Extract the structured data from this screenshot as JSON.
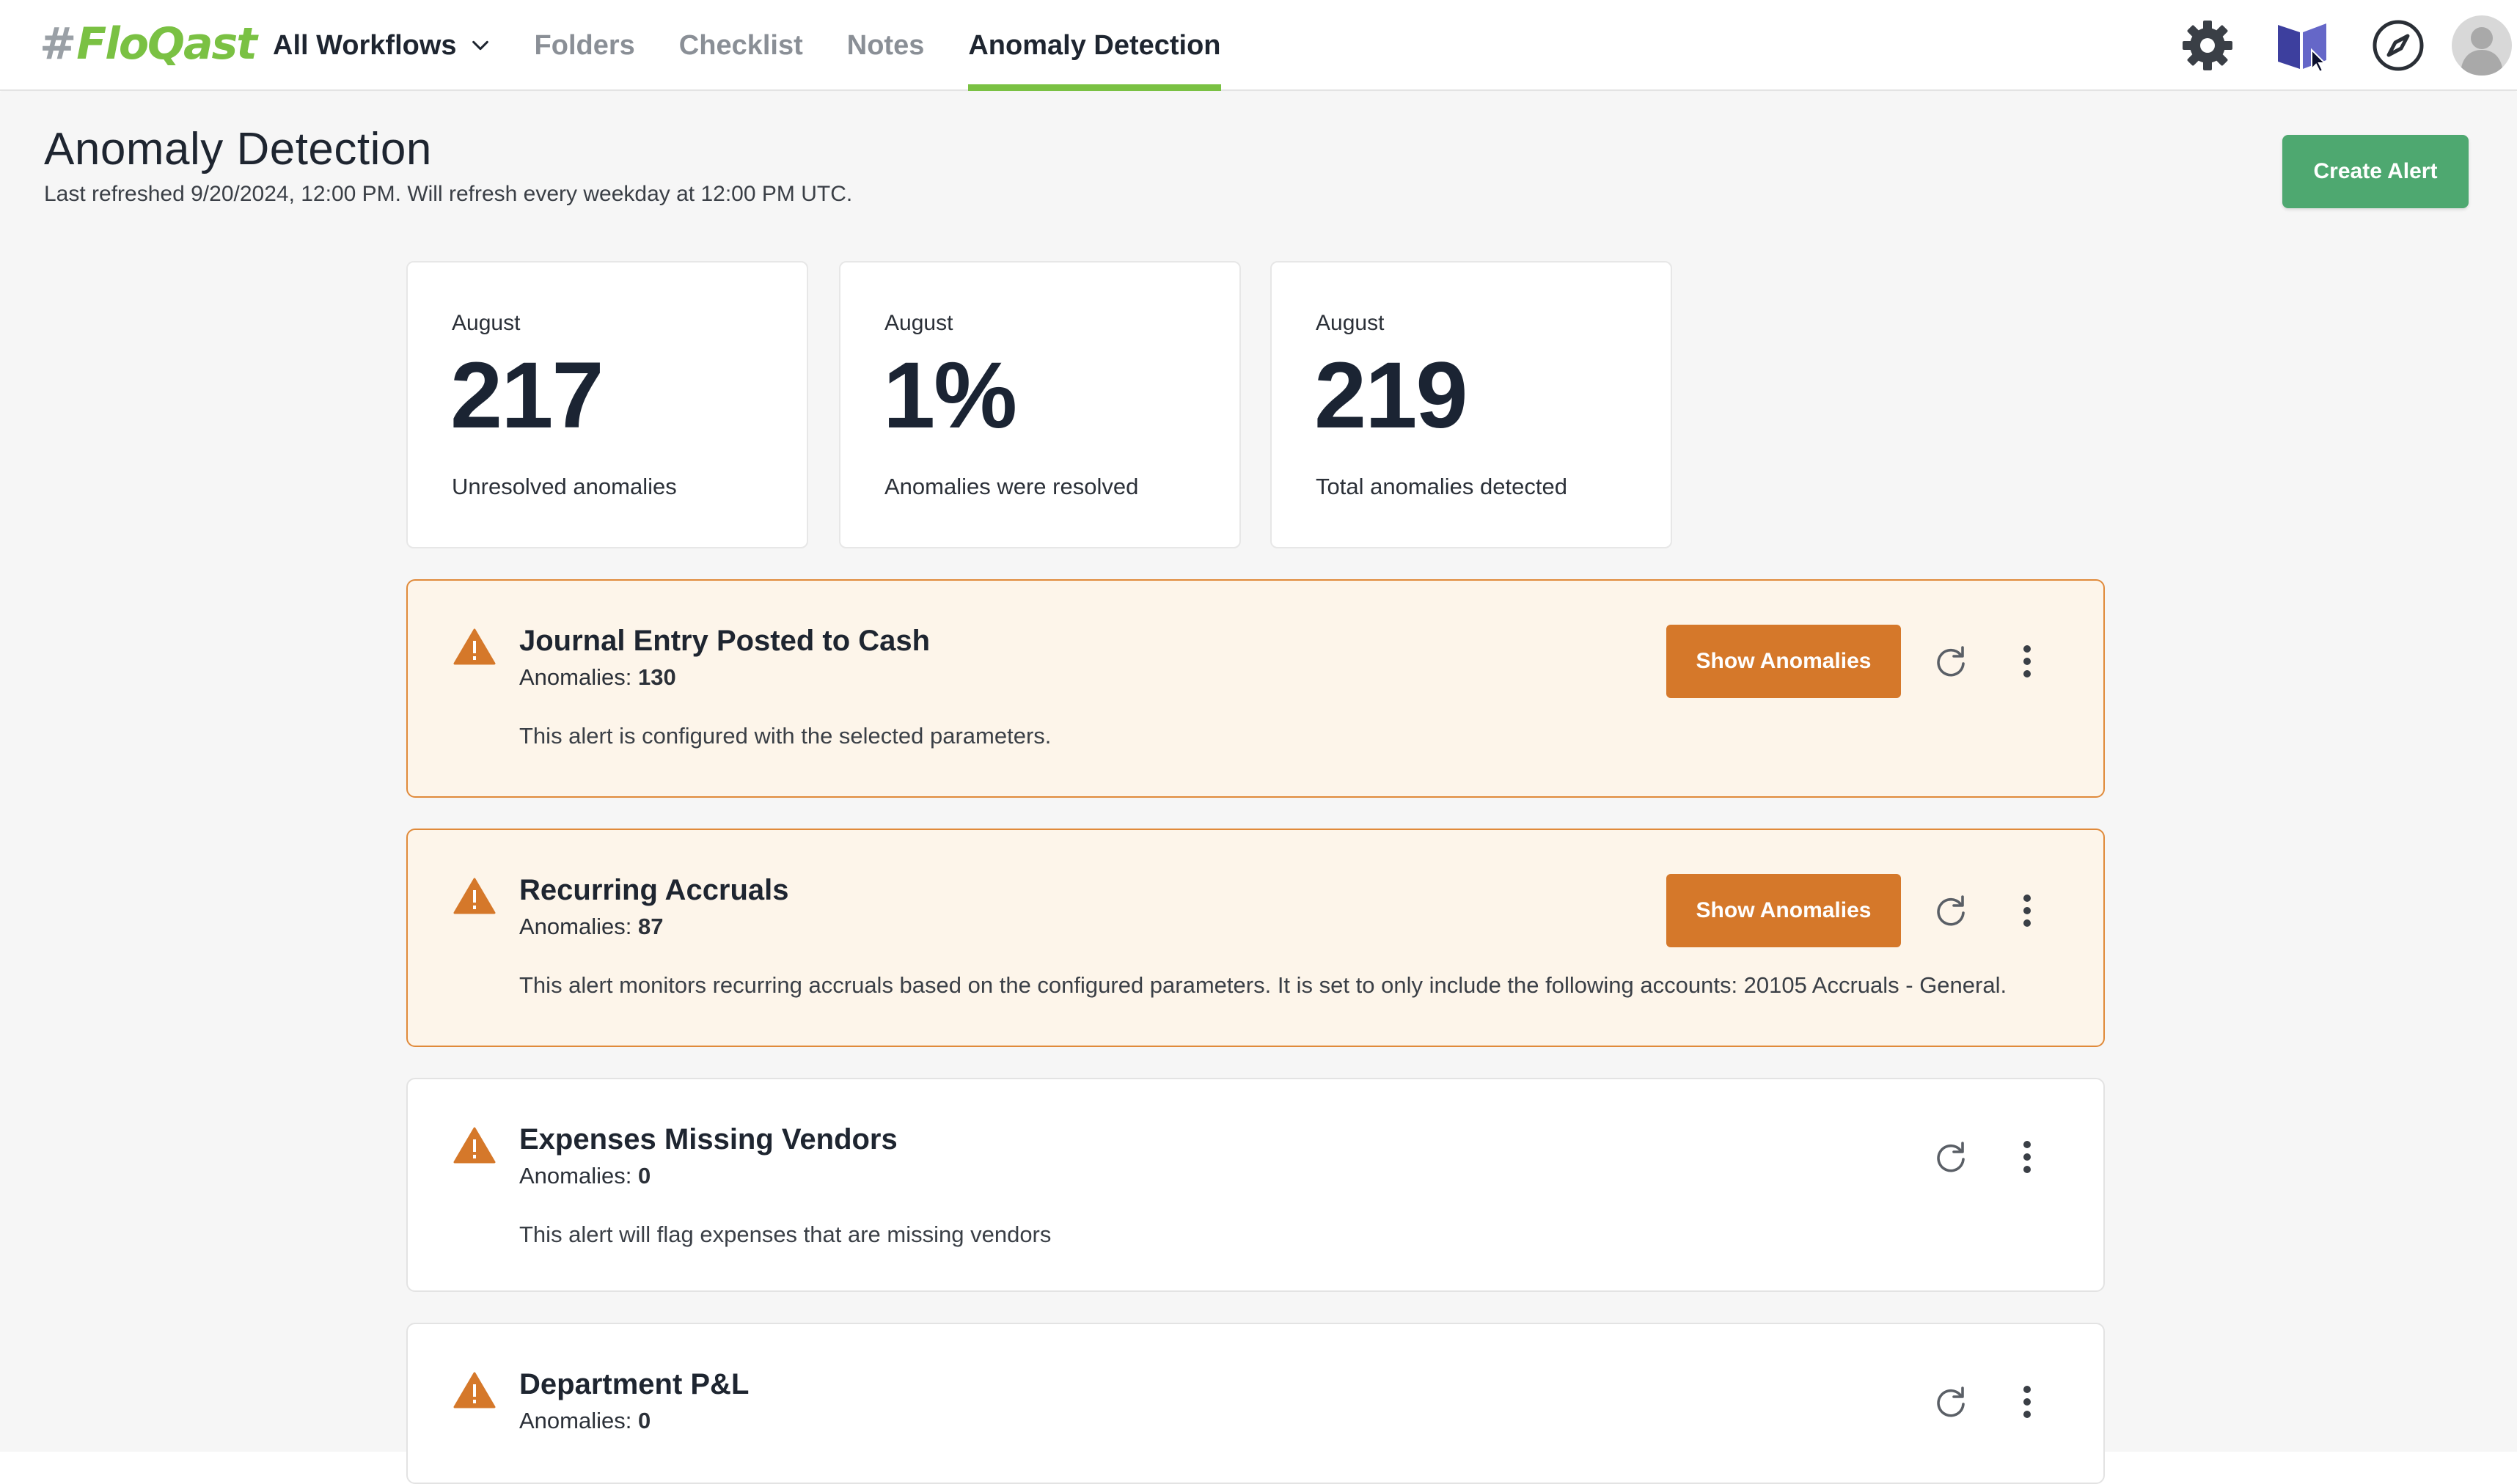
{
  "brand": {
    "name": "FloQast",
    "accent": "#7ac143"
  },
  "nav": {
    "workflows_label": "All Workflows",
    "tabs": [
      {
        "label": "Folders",
        "active": false
      },
      {
        "label": "Checklist",
        "active": false
      },
      {
        "label": "Notes",
        "active": false
      },
      {
        "label": "Anomaly Detection",
        "active": true
      }
    ],
    "right_icons": [
      "compass-icon",
      "book-icon",
      "gear-icon",
      "avatar"
    ]
  },
  "page": {
    "title": "Anomaly Detection",
    "subtitle": "Last refreshed 9/20/2024, 12:00 PM. Will refresh every weekday at 12:00 PM UTC.",
    "create_label": "Create Alert"
  },
  "stats": [
    {
      "month": "August",
      "value": "217",
      "label": "Unresolved anomalies"
    },
    {
      "month": "August",
      "value": "1%",
      "label": "Anomalies were resolved"
    },
    {
      "month": "August",
      "value": "219",
      "label": "Total anomalies detected"
    }
  ],
  "alerts": [
    {
      "title": "Journal Entry Posted to Cash",
      "count_label": "Anomalies:",
      "count": "130",
      "description": "This alert is configured with the selected parameters.",
      "action_label": "Show Anomalies",
      "status": "warning"
    },
    {
      "title": "Recurring Accruals",
      "count_label": "Anomalies:",
      "count": "87",
      "description": "This alert monitors recurring accruals based on the configured parameters. It is set to only include the following accounts: 20105 Accruals - General.",
      "action_label": "Show Anomalies",
      "status": "warning"
    },
    {
      "title": "Expenses Missing Vendors",
      "count_label": "Anomalies:",
      "count": "0",
      "description": "This alert will flag expenses that are missing vendors",
      "status": "normal"
    },
    {
      "title": "Department P&L",
      "count_label": "Anomalies:",
      "count": "0",
      "description": "",
      "status": "normal"
    }
  ],
  "colors": {
    "warning_bg": "#fdf5ea",
    "warning_border": "#e08a3a",
    "warning_button": "#d5782a",
    "warning_icon": "#d5782a",
    "create_button": "#4ea870",
    "active_tab_underline": "#7ac143"
  }
}
